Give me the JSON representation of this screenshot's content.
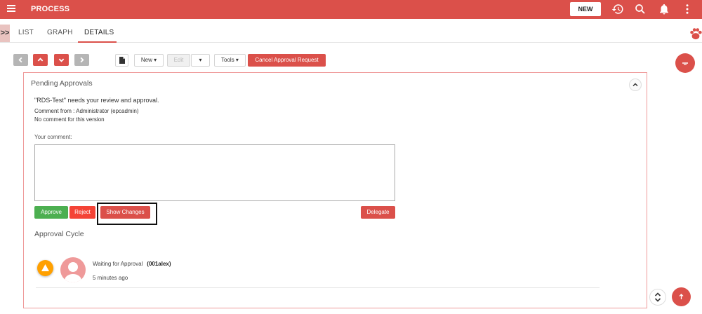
{
  "app": {
    "title": "PROCESS",
    "new_label": "NEW",
    "accent": "#db504a"
  },
  "tabs": [
    {
      "label": "LIST",
      "active": false
    },
    {
      "label": "GRAPH",
      "active": false
    },
    {
      "label": "DETAILS",
      "active": true
    }
  ],
  "toolbar": {
    "new_label": "New ▾",
    "edit_label": "Edit",
    "edit_caret": "▾",
    "tools_label": "Tools ▾",
    "cancel_label": "Cancel Approval Request"
  },
  "panel": {
    "title": "Pending Approvals",
    "review_text": "\"RDS-Test\" needs your review and approval.",
    "comment_from": "Comment from : Administrator (epcadmin)",
    "no_comment": "No comment for this version",
    "your_comment_label": "Your comment:",
    "comment_value": "",
    "buttons": {
      "approve": "Approve",
      "reject": "Reject",
      "show_changes": "Show Changes",
      "delegate": "Delegate"
    },
    "approve_color": "#4caf50",
    "reject_color": "#f44336"
  },
  "cycle": {
    "title": "Approval Cycle",
    "items": [
      {
        "status": "Waiting for Approval",
        "user": "(001alex)",
        "time": "5 minutes ago",
        "status_color": "#ffa000"
      }
    ]
  },
  "icons": {
    "menu": "hamburger-icon",
    "history": "history-icon",
    "search": "search-icon",
    "notifications": "bell-icon",
    "more": "more-vert-icon",
    "paw": "paw-icon",
    "document": "document-icon"
  }
}
